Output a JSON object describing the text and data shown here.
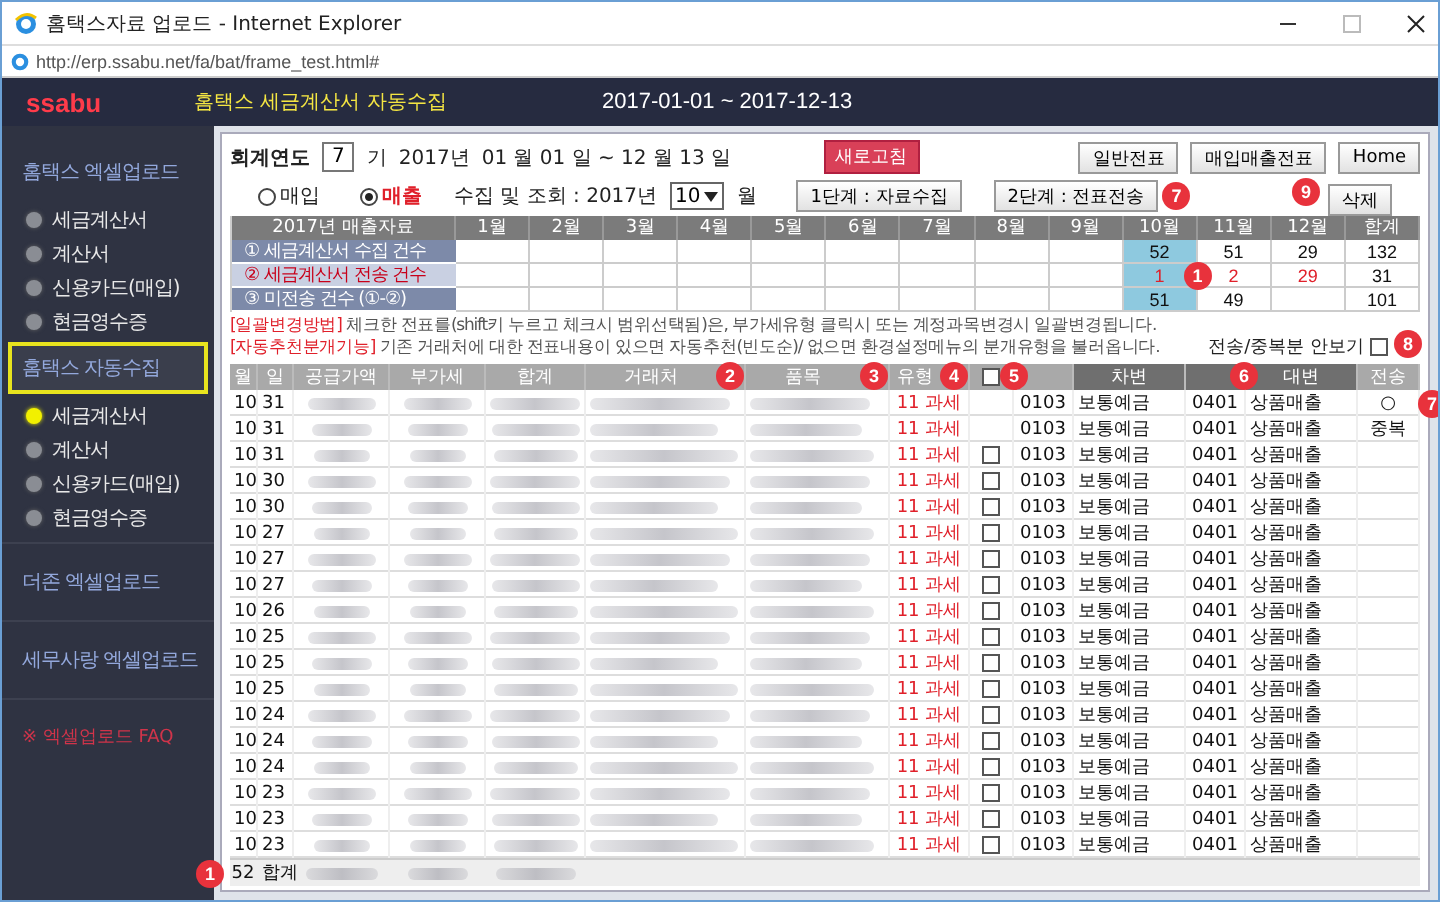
{
  "window": {
    "title": "홈택스자료 업로드 - Internet Explorer",
    "address": "http://erp.ssabu.net/fa/bat/frame_test.html#"
  },
  "header": {
    "logo": "ssabu",
    "title": "홈택스 세금계산서 자동수집",
    "period": "2017-01-01 ~ 2017-12-13"
  },
  "sidebar": {
    "sections": [
      {
        "label": "홈택스 엑셀업로드",
        "selected": false,
        "items": [
          {
            "label": "세금계산서",
            "selected": false
          },
          {
            "label": "계산서",
            "selected": false
          },
          {
            "label": "신용카드(매입)",
            "selected": false
          },
          {
            "label": "현금영수증",
            "selected": false
          }
        ]
      },
      {
        "label": "홈택스 자동수집",
        "selected": true,
        "items": [
          {
            "label": "세금계산서",
            "selected": true
          },
          {
            "label": "계산서",
            "selected": false
          },
          {
            "label": "신용카드(매입)",
            "selected": false
          },
          {
            "label": "현금영수증",
            "selected": false
          }
        ]
      },
      {
        "label": "더존 엑셀업로드",
        "selected": false
      },
      {
        "label": "세무사랑 엑셀업로드",
        "selected": false
      }
    ],
    "faq": "※ 엑셀업로드 FAQ"
  },
  "toolbar": {
    "fiscal_label": "회계연도",
    "term": "7",
    "term_unit": "기",
    "year": "2017년",
    "range": "01 월 01 일 ~ 12 월 13 일",
    "refresh": "새로고침",
    "buttons": [
      "일반전표",
      "매입매출전표",
      "Home"
    ]
  },
  "controls": {
    "radios": [
      {
        "label": "매입",
        "selected": false
      },
      {
        "label": "매출",
        "selected": true
      }
    ],
    "month_label": "수집 및 조회 : 2017년",
    "month": "10",
    "month_unit": "월",
    "steps": [
      {
        "label": "1단계 : 자료수집"
      },
      {
        "label": "2단계 : 전표전송",
        "badge": "7"
      }
    ],
    "delete": {
      "label": "삭제",
      "badge": "9"
    }
  },
  "summary": {
    "title": "2017년 매출자료",
    "columns": [
      {
        "label": "1월",
        "selected": false
      },
      {
        "label": "2월",
        "selected": false
      },
      {
        "label": "3월",
        "selected": false
      },
      {
        "label": "4월",
        "selected": false
      },
      {
        "label": "5월",
        "selected": false
      },
      {
        "label": "6월",
        "selected": false
      },
      {
        "label": "7월",
        "selected": false
      },
      {
        "label": "8월",
        "selected": false
      },
      {
        "label": "9월",
        "selected": false
      },
      {
        "label": "10월",
        "selected": true,
        "badge": "1"
      },
      {
        "label": "11월",
        "selected": false
      },
      {
        "label": "12월",
        "selected": false
      }
    ],
    "total_label": "합계",
    "rows": [
      {
        "label": "① 세금계산서 수집 건수",
        "emphasis": false,
        "values": [
          {
            "empty": true
          },
          {
            "empty": true
          },
          {
            "empty": true
          },
          {
            "empty": true
          },
          {
            "empty": true
          },
          {
            "empty": true
          },
          {
            "empty": true
          },
          {
            "empty": true
          },
          {
            "empty": true
          },
          {
            "value": "52"
          },
          {
            "value": "51"
          },
          {
            "value": "29"
          }
        ],
        "total": "132"
      },
      {
        "label": "② 세금계산서 전송 건수",
        "emphasis": true,
        "values": [
          {
            "empty": true
          },
          {
            "empty": true
          },
          {
            "empty": true
          },
          {
            "empty": true
          },
          {
            "empty": true
          },
          {
            "empty": true
          },
          {
            "empty": true
          },
          {
            "empty": true
          },
          {
            "empty": true
          },
          {
            "value": "1"
          },
          {
            "value": "2"
          },
          {
            "value": "29"
          }
        ],
        "total": "31"
      },
      {
        "label": "③ 미전송 건수 (①-②)",
        "emphasis": false,
        "values": [
          {
            "empty": true
          },
          {
            "empty": true
          },
          {
            "empty": true
          },
          {
            "empty": true
          },
          {
            "empty": true
          },
          {
            "empty": true
          },
          {
            "empty": true
          },
          {
            "empty": true
          },
          {
            "empty": true
          },
          {
            "value": "51"
          },
          {
            "value": "49"
          },
          {
            "empty": true
          }
        ],
        "total": "101"
      }
    ]
  },
  "notes": [
    {
      "tag": "[일괄변경방법]",
      "text": "체크한 전표를(shift키 누르고 체크시 범위선택됨)은, 부가세유형 클릭시 또는 계정과목변경시 일괄변경됩니다."
    },
    {
      "tag": "[자동추천분개기능]",
      "text": "기존 거래처에 대한 전표내용이 있으면 자동추천(빈도순)/ 없으면 환경설정메뉴의 분개유형을 불러옵니다."
    }
  ],
  "hide_sent": {
    "label": "전송/중복분 안보기",
    "checked": false,
    "badge": "8"
  },
  "grid": {
    "columns": [
      {
        "kind": "text",
        "label": "월"
      },
      {
        "kind": "text",
        "label": "일"
      },
      {
        "kind": "text",
        "label": "공급가액"
      },
      {
        "kind": "text",
        "label": "부가세"
      },
      {
        "kind": "text",
        "label": "합계"
      },
      {
        "kind": "text",
        "label": "거래처",
        "badge": "2"
      },
      {
        "kind": "text",
        "label": "품목",
        "badge": "3"
      },
      {
        "kind": "text",
        "label": "유형",
        "badge": "4"
      },
      {
        "kind": "checkbox",
        "checked": false,
        "badge": "5"
      },
      {
        "kind": "blank"
      },
      {
        "kind": "text",
        "label": "차변",
        "dark": true
      },
      {
        "kind": "blank",
        "dark": true,
        "badge": "6"
      },
      {
        "kind": "text",
        "label": "대변",
        "dark": true
      },
      {
        "kind": "text",
        "label": "전송"
      }
    ],
    "rows": [
      {
        "month": "10",
        "day": "31",
        "type": "11 과세",
        "kind": "sent",
        "status": "○",
        "badge": "7",
        "debit_code": "0103",
        "debit_name": "보통예금",
        "credit_code": "0401",
        "credit_name": "상품매출"
      },
      {
        "month": "10",
        "day": "31",
        "type": "11 과세",
        "kind": "duplicate",
        "status": "중복",
        "debit_code": "0103",
        "debit_name": "보통예금",
        "credit_code": "0401",
        "credit_name": "상품매출"
      },
      {
        "month": "10",
        "day": "31",
        "type": "11 과세",
        "kind": "open",
        "checked": false,
        "debit_code": "0103",
        "debit_name": "보통예금",
        "credit_code": "0401",
        "credit_name": "상품매출"
      },
      {
        "month": "10",
        "day": "30",
        "type": "11 과세",
        "kind": "open",
        "checked": false,
        "debit_code": "0103",
        "debit_name": "보통예금",
        "credit_code": "0401",
        "credit_name": "상품매출"
      },
      {
        "month": "10",
        "day": "30",
        "type": "11 과세",
        "kind": "open",
        "checked": false,
        "debit_code": "0103",
        "debit_name": "보통예금",
        "credit_code": "0401",
        "credit_name": "상품매출"
      },
      {
        "month": "10",
        "day": "27",
        "type": "11 과세",
        "kind": "open",
        "checked": false,
        "debit_code": "0103",
        "debit_name": "보통예금",
        "credit_code": "0401",
        "credit_name": "상품매출"
      },
      {
        "month": "10",
        "day": "27",
        "type": "11 과세",
        "kind": "open",
        "checked": false,
        "debit_code": "0103",
        "debit_name": "보통예금",
        "credit_code": "0401",
        "credit_name": "상품매출"
      },
      {
        "month": "10",
        "day": "27",
        "type": "11 과세",
        "kind": "open",
        "checked": false,
        "debit_code": "0103",
        "debit_name": "보통예금",
        "credit_code": "0401",
        "credit_name": "상품매출"
      },
      {
        "month": "10",
        "day": "26",
        "type": "11 과세",
        "kind": "open",
        "checked": false,
        "debit_code": "0103",
        "debit_name": "보통예금",
        "credit_code": "0401",
        "credit_name": "상품매출"
      },
      {
        "month": "10",
        "day": "25",
        "type": "11 과세",
        "kind": "open",
        "checked": false,
        "debit_code": "0103",
        "debit_name": "보통예금",
        "credit_code": "0401",
        "credit_name": "상품매출"
      },
      {
        "month": "10",
        "day": "25",
        "type": "11 과세",
        "kind": "open",
        "checked": false,
        "debit_code": "0103",
        "debit_name": "보통예금",
        "credit_code": "0401",
        "credit_name": "상품매출"
      },
      {
        "month": "10",
        "day": "25",
        "type": "11 과세",
        "kind": "open",
        "checked": false,
        "debit_code": "0103",
        "debit_name": "보통예금",
        "credit_code": "0401",
        "credit_name": "상품매출"
      },
      {
        "month": "10",
        "day": "24",
        "type": "11 과세",
        "kind": "open",
        "checked": false,
        "debit_code": "0103",
        "debit_name": "보통예금",
        "credit_code": "0401",
        "credit_name": "상품매출"
      },
      {
        "month": "10",
        "day": "24",
        "type": "11 과세",
        "kind": "open",
        "checked": false,
        "debit_code": "0103",
        "debit_name": "보통예금",
        "credit_code": "0401",
        "credit_name": "상품매출"
      },
      {
        "month": "10",
        "day": "24",
        "type": "11 과세",
        "kind": "open",
        "checked": false,
        "debit_code": "0103",
        "debit_name": "보통예금",
        "credit_code": "0401",
        "credit_name": "상품매출"
      },
      {
        "month": "10",
        "day": "23",
        "type": "11 과세",
        "kind": "open",
        "checked": false,
        "debit_code": "0103",
        "debit_name": "보통예금",
        "credit_code": "0401",
        "credit_name": "상품매출"
      },
      {
        "month": "10",
        "day": "23",
        "type": "11 과세",
        "kind": "open",
        "checked": false,
        "debit_code": "0103",
        "debit_name": "보통예금",
        "credit_code": "0401",
        "credit_name": "상품매출"
      },
      {
        "month": "10",
        "day": "23",
        "type": "11 과세",
        "kind": "open",
        "checked": false,
        "debit_code": "0103",
        "debit_name": "보통예금",
        "credit_code": "0401",
        "credit_name": "상품매출"
      }
    ],
    "footer": {
      "count": "52",
      "label": "합계",
      "badge": "1"
    }
  }
}
